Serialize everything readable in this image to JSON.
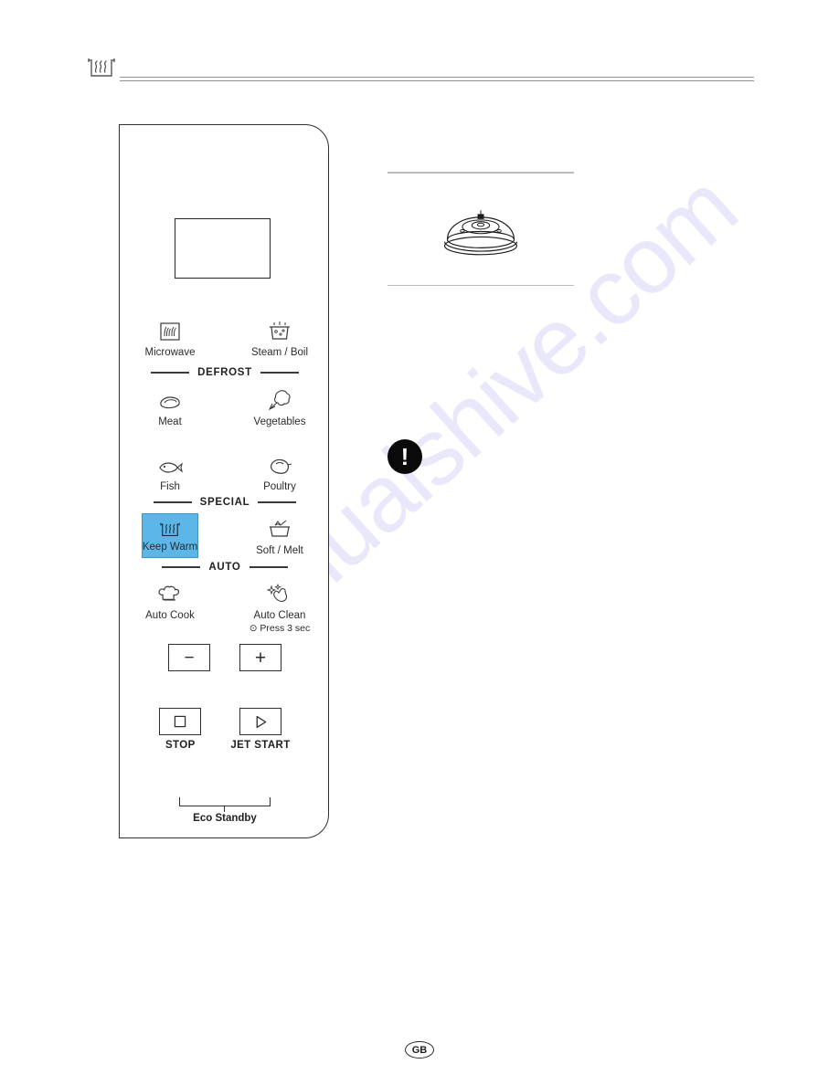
{
  "header": {
    "icon": "keep-warm-steam-icon"
  },
  "panel": {
    "display_value": "",
    "rows": [
      {
        "keys": [
          {
            "icon": "microwave-waves-icon",
            "label": "Microwave",
            "sublabel": "",
            "highlight": false
          },
          {
            "icon": "steam-boil-pot-icon",
            "label": "Steam / Boil",
            "sublabel": "",
            "highlight": false
          }
        ]
      },
      {
        "keys": [
          {
            "icon": "meat-steak-icon",
            "label": "Meat",
            "sublabel": "",
            "highlight": false
          },
          {
            "icon": "vegetables-icon",
            "label": "Vegetables",
            "sublabel": "",
            "highlight": false
          }
        ]
      },
      {
        "keys": [
          {
            "icon": "fish-icon",
            "label": "Fish",
            "sublabel": "",
            "highlight": false
          },
          {
            "icon": "poultry-chicken-icon",
            "label": "Poultry",
            "sublabel": "",
            "highlight": false
          }
        ]
      },
      {
        "keys": [
          {
            "icon": "keep-warm-steam-icon",
            "label": "Keep Warm",
            "sublabel": "",
            "highlight": true
          },
          {
            "icon": "soft-melt-icon",
            "label": "Soft / Melt",
            "sublabel": "",
            "highlight": false
          }
        ]
      },
      {
        "keys": [
          {
            "icon": "chef-hat-icon",
            "label": "Auto Cook",
            "sublabel": "",
            "highlight": false
          },
          {
            "icon": "auto-clean-sparkle-icon",
            "label": "Auto Clean",
            "sublabel": "⊙ Press 3 sec",
            "highlight": false
          }
        ]
      }
    ],
    "dividers": [
      {
        "caption": "DEFROST"
      },
      {
        "caption": "SPECIAL"
      },
      {
        "caption": "AUTO"
      }
    ],
    "minus_label": "−",
    "plus_label": "+",
    "eco_standby_label": "Eco Standby",
    "stop_label": "STOP",
    "jet_start_label": "JET START"
  },
  "right": {
    "figure_icon": "covered-dish-icon",
    "warning_symbol": "!"
  },
  "footer": {
    "locale_badge": "GB"
  },
  "watermark": {
    "text": "manualshive.com"
  },
  "colors": {
    "highlight": "#5cb7e8",
    "ink": "#2b2b2b",
    "rule": "#8d9195"
  }
}
